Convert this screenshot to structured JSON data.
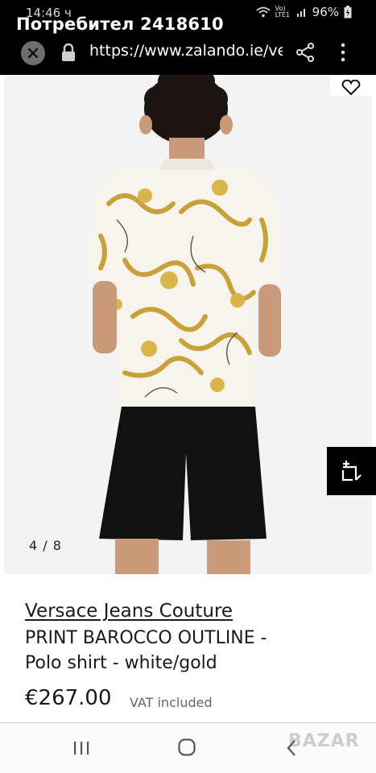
{
  "status_bar": {
    "time": "14:46 ч",
    "network": "Vo) LTE1",
    "battery": "96%"
  },
  "browser": {
    "title": "Потребител 2418610",
    "url": "https://www.zalando.ie/ve",
    "icons": [
      "close-icon",
      "lock-icon",
      "share-icon",
      "more-vertical-icon"
    ]
  },
  "gallery": {
    "counter": "4 / 8",
    "icons": [
      "heart-icon",
      "crop-add-icon"
    ]
  },
  "product": {
    "brand": "Versace Jeans Couture",
    "title_line1": "PRINT BAROCCO OUTLINE -",
    "title_line2": "Polo shirt - white/gold",
    "price": "€267.00",
    "vat_note": "VAT included"
  },
  "nav_bar": {
    "icons": [
      "recent-apps-icon",
      "home-icon",
      "back-icon"
    ],
    "watermark": "BAZAR"
  },
  "colors": {
    "topbar": "#000000",
    "accent_gold": "#c8a13a",
    "shorts": "#111111"
  }
}
